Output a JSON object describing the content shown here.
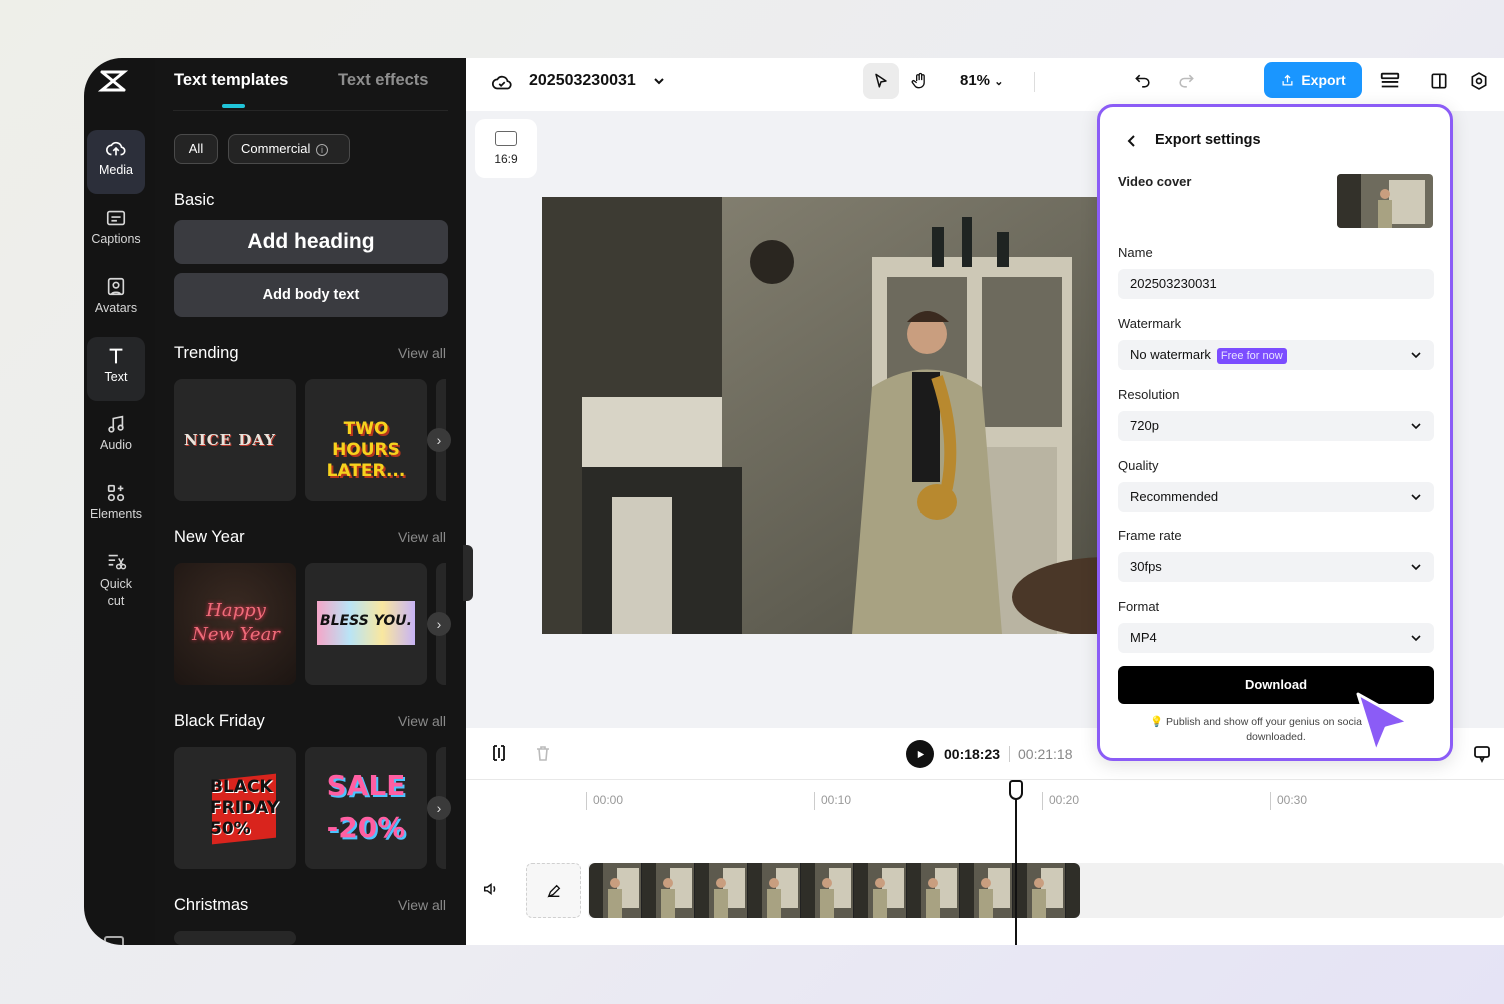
{
  "sidebar": {
    "items": [
      {
        "label": "Media"
      },
      {
        "label": "Captions"
      },
      {
        "label": "Avatars"
      },
      {
        "label": "Text"
      },
      {
        "label": "Audio"
      },
      {
        "label": "Elements"
      },
      {
        "label": "Quick cut"
      }
    ]
  },
  "panel": {
    "tabs": [
      "Text templates",
      "Text effects"
    ],
    "filters": [
      "All",
      "Commercial"
    ],
    "basic_title": "Basic",
    "add_heading": "Add heading",
    "add_body": "Add body text",
    "sections": [
      {
        "title": "Trending",
        "view_all": "View all",
        "cards": [
          "NICE DAY",
          "TWO HOURS LATER..."
        ]
      },
      {
        "title": "New Year",
        "view_all": "View all",
        "cards": [
          "Happy New Year",
          "BLESS YOU."
        ]
      },
      {
        "title": "Black Friday",
        "view_all": "View all",
        "cards": [
          "BLACK FRIDAY 50%",
          "SALE -20%"
        ]
      },
      {
        "title": "Christmas",
        "view_all": "View all",
        "cards": []
      }
    ]
  },
  "topbar": {
    "project_name": "202503230031",
    "zoom": "81%",
    "export_label": "Export"
  },
  "stage": {
    "ratio_label": "16:9"
  },
  "timeline": {
    "current_time": "00:18:23",
    "total_time": "00:21:18",
    "ruler": [
      "00:00",
      "00:10",
      "00:20",
      "00:30"
    ]
  },
  "export_dialog": {
    "title": "Export settings",
    "video_cover_label": "Video cover",
    "name_label": "Name",
    "name_value": "202503230031",
    "watermark_label": "Watermark",
    "watermark_value": "No watermark",
    "watermark_badge": "Free for now",
    "resolution_label": "Resolution",
    "resolution_value": "720p",
    "quality_label": "Quality",
    "quality_value": "Recommended",
    "framerate_label": "Frame rate",
    "framerate_value": "30fps",
    "format_label": "Format",
    "format_value": "MP4",
    "download_label": "Download",
    "note": "Publish and show off your genius on socia",
    "note_tail": "ce",
    "note_line2": "downloaded."
  },
  "colors": {
    "accent": "#1a96ff",
    "dialog_border": "#8b5cf6",
    "tab_indicator": "#20c4d9",
    "badge": "#7c4dff"
  }
}
